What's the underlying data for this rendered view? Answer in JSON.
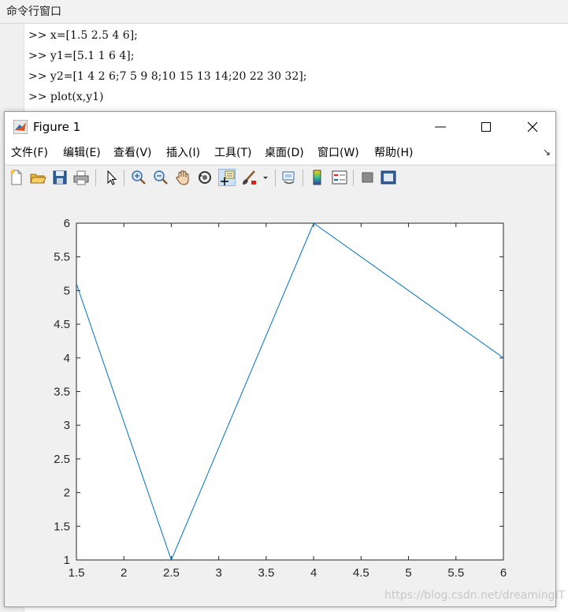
{
  "command_window": {
    "title": "命令行窗口",
    "lines": [
      ">> x=[1.5 2.5 4 6];",
      ">> y1=[5.1 1 6 4];",
      ">> y2=[1 4 2 6;7 5 9 8;10 15 13 14;20 22 30 32];",
      ">> plot(x,y1)"
    ]
  },
  "figure": {
    "title": "Figure 1",
    "menu": [
      "文件(F)",
      "编辑(E)",
      "查看(V)",
      "插入(I)",
      "工具(T)",
      "桌面(D)",
      "窗口(W)",
      "帮助(H)"
    ],
    "toolbar_icons": [
      "new-figure-icon",
      "open-file-icon",
      "save-icon",
      "print-icon",
      "pointer-icon",
      "zoom-in-icon",
      "zoom-out-icon",
      "pan-icon",
      "rotate-3d-icon",
      "data-cursor-icon",
      "brush-icon",
      "link-plot-icon",
      "colorbar-icon",
      "legend-icon",
      "hide-plot-tools-icon",
      "show-plot-tools-icon"
    ],
    "watermark": "https://blog.csdn.net/dreamingIT"
  },
  "chart_data": {
    "type": "line",
    "x": [
      1.5,
      2.5,
      4,
      6
    ],
    "series": [
      {
        "values": [
          5.1,
          1,
          6,
          4
        ],
        "color": "#0072bd"
      }
    ],
    "xlim": [
      1.5,
      6
    ],
    "ylim": [
      1,
      6
    ],
    "xticks": [
      "1.5",
      "2",
      "2.5",
      "3",
      "3.5",
      "4",
      "4.5",
      "5",
      "5.5",
      "6"
    ],
    "yticks": [
      "1",
      "1.5",
      "2",
      "2.5",
      "3",
      "3.5",
      "4",
      "4.5",
      "5",
      "5.5",
      "6"
    ],
    "grid": false,
    "title": "",
    "xlabel": "",
    "ylabel": ""
  }
}
